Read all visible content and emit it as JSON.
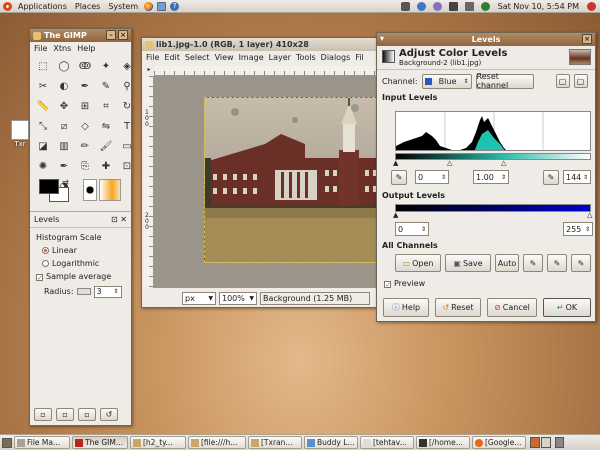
{
  "top_panel": {
    "menus": [
      "Applications",
      "Places",
      "System"
    ],
    "datetime": "Sat Nov 10,  5:54 PM"
  },
  "desktop": {
    "icon_label": "Txr"
  },
  "toolbox": {
    "title": "The GIMP",
    "menus": [
      "File",
      "Xtns",
      "Help"
    ],
    "tools": [
      "rect-select",
      "ellipse-select",
      "free-select",
      "fuzzy-select",
      "by-color-select",
      "scissors",
      "foreground-select",
      "paths",
      "color-picker",
      "zoom",
      "measure",
      "move",
      "align",
      "crop",
      "rotate",
      "scale",
      "shear",
      "perspective",
      "flip",
      "text",
      "bucket-fill",
      "blend",
      "pencil",
      "paintbrush",
      "eraser",
      "airbrush",
      "ink",
      "clone",
      "heal",
      "perspective-clone",
      "smudge",
      "dodge-burn"
    ],
    "levels_panel": {
      "title": "Levels",
      "histogram_scale": "Histogram Scale",
      "linear": "Linear",
      "logarithmic": "Logarithmic",
      "sample_average": "Sample average",
      "radius_label": "Radius:",
      "radius_value": "3"
    }
  },
  "image_window": {
    "title": "lib1.jpg-1.0 (RGB, 1 layer) 410x28",
    "menus": [
      "File",
      "Edit",
      "Select",
      "View",
      "Image",
      "Layer",
      "Tools",
      "Dialogs",
      "Fil"
    ],
    "ruler_ticks_v": [
      "1",
      "0",
      "0",
      "2",
      "0",
      "0"
    ],
    "unit": "px",
    "zoom": "100%",
    "status": "Background (1.25 MB)"
  },
  "levels_dialog": {
    "window_title": "Levels",
    "heading": "Adjust Color Levels",
    "subheading": "Background-2 (lib1.jpg)",
    "channel_label": "Channel:",
    "channel_value": "Blue",
    "reset_channel": "Reset channel",
    "input_levels": "Input Levels",
    "input_low": "0",
    "input_gamma": "1.00",
    "input_high": "144",
    "output_levels": "Output Levels",
    "output_low": "0",
    "output_high": "255",
    "all_channels": "All Channels",
    "open": "Open",
    "save": "Save",
    "auto": "Auto",
    "preview": "Preview",
    "help": "Help",
    "reset": "Reset",
    "cancel": "Cancel",
    "ok": "OK"
  },
  "taskbar": {
    "items": [
      "File Ma...",
      "The GIM...",
      "[h2_ty...",
      "[file:///h...",
      "[Txran...",
      "Buddy L...",
      "[tehtav...",
      "[/home...",
      "[Google..."
    ]
  },
  "colors": {
    "title_bar": "#9c7650",
    "accent": "#d0601c",
    "highlight": "#0000cc"
  }
}
